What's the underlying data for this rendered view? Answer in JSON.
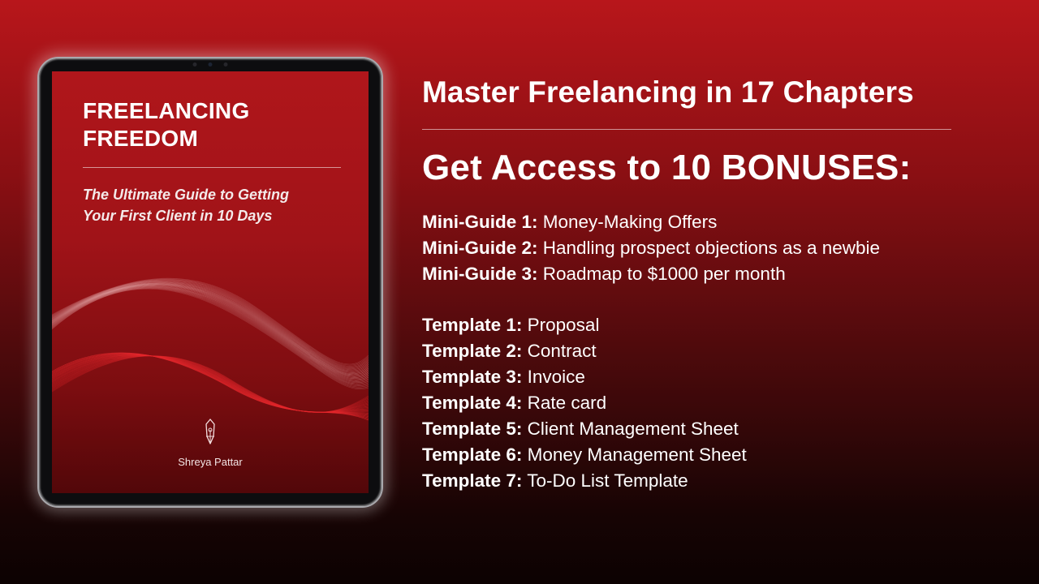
{
  "book": {
    "title_lines": [
      "FREELANCING",
      "FREEDOM"
    ],
    "subtitle_lines": [
      "The Ultimate Guide to Getting",
      "Your First Client in 10 Days"
    ],
    "author": "Shreya Pattar"
  },
  "headline": "Master Freelancing in 17 Chapters",
  "bonus_heading": "Get Access to 10 BONUSES:",
  "mini_guides": [
    {
      "label": "Mini-Guide 1:",
      "text": "Money-Making Offers"
    },
    {
      "label": "Mini-Guide 2:",
      "text": "Handling prospect objections as a newbie"
    },
    {
      "label": "Mini-Guide 3:",
      "text": "Roadmap to $1000 per month"
    }
  ],
  "templates": [
    {
      "label": "Template 1:",
      "text": "Proposal"
    },
    {
      "label": "Template 2:",
      "text": "Contract"
    },
    {
      "label": "Template 3:",
      "text": "Invoice"
    },
    {
      "label": "Template 4:",
      "text": "Rate card"
    },
    {
      "label": "Template 5:",
      "text": "Client Management Sheet"
    },
    {
      "label": "Template 6:",
      "text": "Money Management Sheet"
    },
    {
      "label": "Template 7:",
      "text": "To-Do List Template"
    }
  ],
  "colors": {
    "background_top": "#b8161b",
    "background_bottom": "#0c0202",
    "cover_red": "#a01318",
    "text": "#ffffff"
  },
  "icons": {
    "cover_emblem": "fountain-pen-nib-icon"
  }
}
